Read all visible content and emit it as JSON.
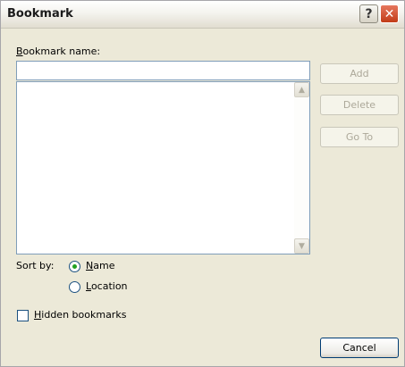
{
  "window": {
    "title": "Bookmark",
    "help_icon": "?",
    "close_icon": "✕"
  },
  "bookmark_name": {
    "label_accel": "B",
    "label_rest": "ookmark name:",
    "value": "",
    "placeholder": ""
  },
  "bookmark_list": {
    "items": [],
    "scroll_up_icon": "▲",
    "scroll_down_icon": "▼"
  },
  "buttons": {
    "add": "Add",
    "delete": "Delete",
    "goto": "Go To",
    "cancel": "Cancel"
  },
  "sort_by": {
    "label": "Sort by:",
    "name_accel": "N",
    "name_rest": "ame",
    "location_accel": "L",
    "location_rest": "ocation",
    "selected": "Name"
  },
  "hidden_bookmarks": {
    "label_accel": "H",
    "label_rest": "idden bookmarks",
    "checked": false
  },
  "colors": {
    "dialog_bg": "#ece9d8",
    "radio_dot": "#21a121",
    "close_button": "#c13b17",
    "input_border": "#7f9db9"
  }
}
